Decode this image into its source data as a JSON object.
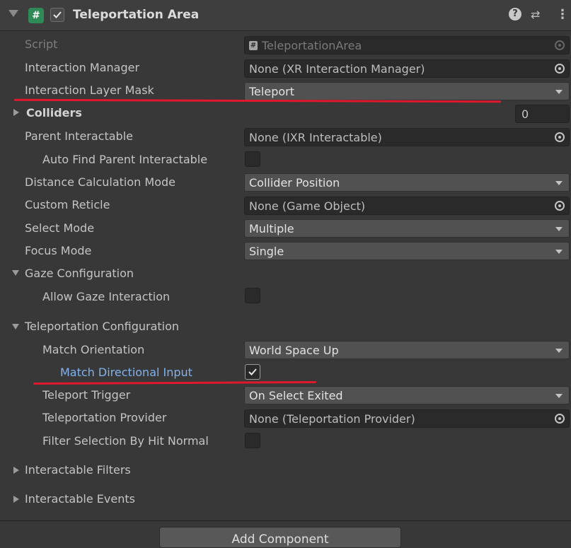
{
  "header": {
    "title": "Teleportation Area",
    "enabled": true,
    "icon": "csharp-script-icon",
    "help_glyph": "?",
    "settings_glyph": "⇄",
    "more_glyph": "⋮"
  },
  "fields": {
    "script": {
      "label": "Script",
      "value": "TeleportationArea"
    },
    "interaction_manager": {
      "label": "Interaction Manager",
      "value": "None (XR Interaction Manager)"
    },
    "interaction_layer_mask": {
      "label": "Interaction Layer Mask",
      "value": "Teleport"
    },
    "colliders": {
      "label": "Colliders",
      "count": "0"
    },
    "parent_interactable": {
      "label": "Parent Interactable",
      "value": "None (IXR Interactable)"
    },
    "auto_find_parent": {
      "label": "Auto Find Parent Interactable",
      "checked": false
    },
    "distance_calc_mode": {
      "label": "Distance Calculation Mode",
      "value": "Collider Position"
    },
    "custom_reticle": {
      "label": "Custom Reticle",
      "value": "None (Game Object)"
    },
    "select_mode": {
      "label": "Select Mode",
      "value": "Multiple"
    },
    "focus_mode": {
      "label": "Focus Mode",
      "value": "Single"
    },
    "gaze_configuration": {
      "label": "Gaze Configuration"
    },
    "allow_gaze": {
      "label": "Allow Gaze Interaction",
      "checked": false
    },
    "teleportation_configuration": {
      "label": "Teleportation Configuration"
    },
    "match_orientation": {
      "label": "Match Orientation",
      "value": "World Space Up"
    },
    "match_directional_input": {
      "label": "Match Directional Input",
      "checked": true
    },
    "teleport_trigger": {
      "label": "Teleport Trigger",
      "value": "On Select Exited"
    },
    "teleportation_provider": {
      "label": "Teleportation Provider",
      "value": "None (Teleportation Provider)"
    },
    "filter_selection": {
      "label": "Filter Selection By Hit Normal",
      "checked": false
    },
    "interactable_filters": {
      "label": "Interactable Filters"
    },
    "interactable_events": {
      "label": "Interactable Events"
    }
  },
  "footer": {
    "add_component_label": "Add Component"
  },
  "colors": {
    "background": "#383838",
    "highlight_blue": "#7fb2ef",
    "annotation_red": "#e0182d"
  }
}
